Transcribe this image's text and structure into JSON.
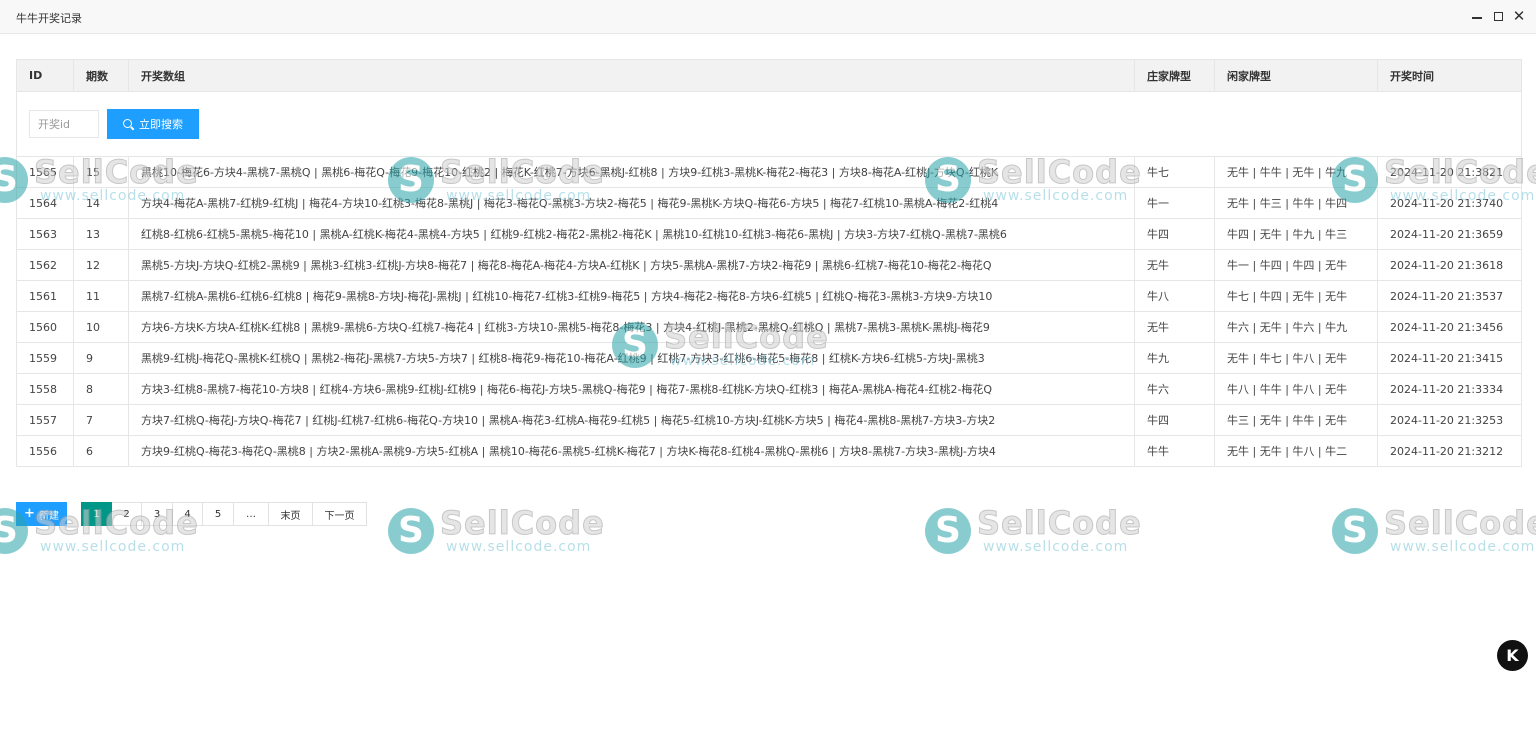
{
  "window": {
    "title": "牛牛开奖记录",
    "controls": [
      "minimize-icon",
      "maximize-icon",
      "close-icon"
    ]
  },
  "table": {
    "columns": [
      "ID",
      "期数",
      "开奖数组",
      "庄家牌型",
      "闲家牌型",
      "开奖时间"
    ],
    "rows": [
      [
        "1565",
        "15",
        "黑桃10-梅花6-方块4-黑桃7-黑桃Q | 黑桃6-梅花Q-梅花9-梅花10-红桃2 | 梅花K-红桃7-方块6-黑桃J-红桃8 | 方块9-红桃3-黑桃K-梅花2-梅花3 | 方块8-梅花A-红桃J-方块Q-红桃K",
        "牛七",
        "无牛 | 牛牛 | 无牛 | 牛九",
        "2024-11-20 21:3821"
      ],
      [
        "1564",
        "14",
        "方块4-梅花A-黑桃7-红桃9-红桃J | 梅花4-方块10-红桃3-梅花8-黑桃J | 梅花3-梅花Q-黑桃3-方块2-梅花5 | 梅花9-黑桃K-方块Q-梅花6-方块5 | 梅花7-红桃10-黑桃A-梅花2-红桃4",
        "牛一",
        "无牛 | 牛三 | 牛牛 | 牛四",
        "2024-11-20 21:3740"
      ],
      [
        "1563",
        "13",
        "红桃8-红桃6-红桃5-黑桃5-梅花10 | 黑桃A-红桃K-梅花4-黑桃4-方块5 | 红桃9-红桃2-梅花2-黑桃2-梅花K | 黑桃10-红桃10-红桃3-梅花6-黑桃J | 方块3-方块7-红桃Q-黑桃7-黑桃6",
        "牛四",
        "牛四 | 无牛 | 牛九 | 牛三",
        "2024-11-20 21:3659"
      ],
      [
        "1562",
        "12",
        "黑桃5-方块J-方块Q-红桃2-黑桃9 | 黑桃3-红桃3-红桃J-方块8-梅花7 | 梅花8-梅花A-梅花4-方块A-红桃K | 方块5-黑桃A-黑桃7-方块2-梅花9 | 黑桃6-红桃7-梅花10-梅花2-梅花Q",
        "无牛",
        "牛一 | 牛四 | 牛四 | 无牛",
        "2024-11-20 21:3618"
      ],
      [
        "1561",
        "11",
        "黑桃7-红桃A-黑桃6-红桃6-红桃8 | 梅花9-黑桃8-方块J-梅花J-黑桃J | 红桃10-梅花7-红桃3-红桃9-梅花5 | 方块4-梅花2-梅花8-方块6-红桃5 | 红桃Q-梅花3-黑桃3-方块9-方块10",
        "牛八",
        "牛七 | 牛四 | 无牛 | 无牛",
        "2024-11-20 21:3537"
      ],
      [
        "1560",
        "10",
        "方块6-方块K-方块A-红桃K-红桃8 | 黑桃9-黑桃6-方块Q-红桃7-梅花4 | 红桃3-方块10-黑桃5-梅花8-梅花3 | 方块4-红桃J-黑桃2-黑桃Q-红桃Q | 黑桃7-黑桃3-黑桃K-黑桃J-梅花9",
        "无牛",
        "牛六 | 无牛 | 牛六 | 牛九",
        "2024-11-20 21:3456"
      ],
      [
        "1559",
        "9",
        "黑桃9-红桃J-梅花Q-黑桃K-红桃Q | 黑桃2-梅花J-黑桃7-方块5-方块7 | 红桃8-梅花9-梅花10-梅花A-红桃9 | 红桃7-方块3-红桃6-梅花5-梅花8 | 红桃K-方块6-红桃5-方块J-黑桃3",
        "牛九",
        "无牛 | 牛七 | 牛八 | 无牛",
        "2024-11-20 21:3415"
      ],
      [
        "1558",
        "8",
        "方块3-红桃8-黑桃7-梅花10-方块8 | 红桃4-方块6-黑桃9-红桃J-红桃9 | 梅花6-梅花J-方块5-黑桃Q-梅花9 | 梅花7-黑桃8-红桃K-方块Q-红桃3 | 梅花A-黑桃A-梅花4-红桃2-梅花Q",
        "牛六",
        "牛八 | 牛牛 | 牛八 | 无牛",
        "2024-11-20 21:3334"
      ],
      [
        "1557",
        "7",
        "方块7-红桃Q-梅花J-方块Q-梅花7 | 红桃J-红桃7-红桃6-梅花Q-方块10 | 黑桃A-梅花3-红桃A-梅花9-红桃5 | 梅花5-红桃10-方块J-红桃K-方块5 | 梅花4-黑桃8-黑桃7-方块3-方块2",
        "牛四",
        "牛三 | 无牛 | 牛牛 | 无牛",
        "2024-11-20 21:3253"
      ],
      [
        "1556",
        "6",
        "方块9-红桃Q-梅花3-梅花Q-黑桃8 | 方块2-黑桃A-黑桃9-方块5-红桃A | 黑桃10-梅花6-黑桃5-红桃K-梅花7 | 方块K-梅花8-红桃4-黑桃Q-黑桃6 | 方块8-黑桃7-方块3-黑桃J-方块4",
        "牛牛",
        "无牛 | 无牛 | 牛八 | 牛二",
        "2024-11-20 21:3212"
      ]
    ]
  },
  "search": {
    "placeholder": "开奖id",
    "value": "",
    "button_label": "立即搜索"
  },
  "toolbar": {
    "add_label": "新建"
  },
  "pagination": {
    "pages": [
      "1",
      "2",
      "3",
      "4",
      "5"
    ],
    "ellipsis": "…",
    "last_label": "末页",
    "next_label": "下一页",
    "current": "1"
  },
  "watermark": {
    "brand": "SellCode",
    "url": "www.sellcode.com",
    "logo_letter": "S"
  },
  "corner_badge": {
    "letter": "K"
  },
  "colors": {
    "primary": "#1e9fff",
    "pager_active": "#009688",
    "header_bg": "#f2f2f2",
    "watermark_teal": "#2aa3a8"
  }
}
